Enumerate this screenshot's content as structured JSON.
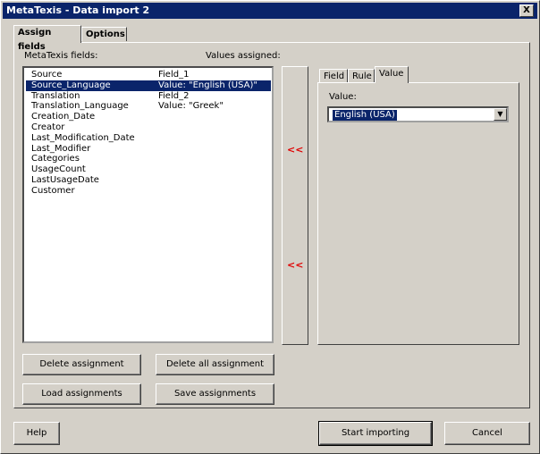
{
  "window": {
    "title": "MetaTexis - Data import 2",
    "close_label": "X"
  },
  "tabs": [
    {
      "label": "Assign fields"
    },
    {
      "label": "Options"
    }
  ],
  "labels": {
    "metatexis_fields": "MetaTexis fields:",
    "values_assigned": "Values assigned:"
  },
  "fields": [
    {
      "name": "Source",
      "value": "Field_1"
    },
    {
      "name": "Source_Language",
      "value": "Value: \"English (USA)\""
    },
    {
      "name": "Translation",
      "value": "Field_2"
    },
    {
      "name": "Translation_Language",
      "value": "Value: \"Greek\""
    },
    {
      "name": "Creation_Date",
      "value": ""
    },
    {
      "name": "Creator",
      "value": ""
    },
    {
      "name": "Last_Modification_Date",
      "value": ""
    },
    {
      "name": "Last_Modifier",
      "value": ""
    },
    {
      "name": "Categories",
      "value": ""
    },
    {
      "name": "UsageCount",
      "value": ""
    },
    {
      "name": "LastUsageDate",
      "value": ""
    },
    {
      "name": "Customer",
      "value": ""
    }
  ],
  "selected_field_index": 1,
  "arrows": {
    "top": "<<",
    "bottom": "<<"
  },
  "subtabs": [
    {
      "label": "Field"
    },
    {
      "label": "Rule"
    },
    {
      "label": "Value"
    }
  ],
  "value_panel": {
    "label": "Value:",
    "selected": "English (USA)"
  },
  "buttons": {
    "delete_assignment": "Delete assignment",
    "delete_all": "Delete all assignment",
    "load": "Load assignments",
    "save": "Save assignments",
    "help": "Help",
    "start": "Start importing",
    "cancel": "Cancel"
  }
}
